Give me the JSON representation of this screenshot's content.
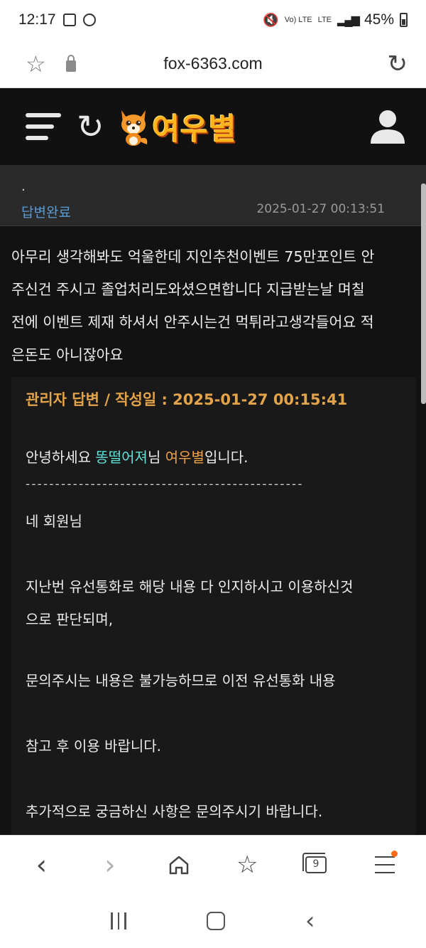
{
  "status_bar": {
    "time": "12:17",
    "volte": "Vo) LTE",
    "network": "LTE",
    "battery": "45%"
  },
  "browser": {
    "url": "fox-6363.com",
    "tab_count": "9"
  },
  "site": {
    "logo_text": "여우별"
  },
  "post": {
    "title": ".",
    "status": "답변완료",
    "date": "2025-01-27 00:13:51",
    "question_lines": [
      "아무리 생각해봐도 억울한데 지인추천이벤트 75만포인트 안",
      "주신건 주시고 졸업처리도와셨으면합니다 지급받는날 며칠",
      "전에 이벤트 제재 하셔서 안주시는건 먹튀라고생각들어요 적",
      "은돈도 아니잖아요"
    ]
  },
  "answer": {
    "header": "관리자 답변 / 작성일 : 2025-01-27 00:15:41",
    "greeting_prefix": "안녕하세요 ",
    "nickname": "똥떨어져",
    "greeting_mid": "님 ",
    "site_name": "여우별",
    "greeting_suffix": "입니다.",
    "divider": "-----------------------------------------------",
    "lines": [
      "네 회원님",
      "지난번 유선통화로 해당 내용 다 인지하시고 이용하신것",
      "으로 판단되며,",
      "문의주시는 내용은 불가능하므로 이전 유선통화 내용",
      "참고 후 이용 바랍니다.",
      "추가적으로 궁금하신 사항은 문의주시기 바랍니다."
    ]
  },
  "colors": {
    "header_bg": "#111111",
    "status_blue": "#5b9bd5",
    "answer_gold": "#e3a34a",
    "nickname_cyan": "#5ee0d6",
    "site_orange": "#f0a045"
  },
  "icons": {
    "status_left": [
      "gallery-icon",
      "messenger-icon"
    ],
    "status_right": [
      "mute-icon",
      "volte-icon",
      "lte-icon",
      "signal-icon",
      "battery-icon"
    ],
    "url_left": [
      "bookmark-star-icon",
      "lock-icon"
    ],
    "url_right": "reload-icon",
    "header": [
      "menu-icon",
      "refresh-icon",
      "fox-logo-icon",
      "user-icon"
    ],
    "bottom_nav": [
      "back-icon",
      "forward-icon",
      "home-icon",
      "bookmarks-icon",
      "tabs-icon",
      "menu-icon"
    ],
    "system_nav": [
      "recent-apps-icon",
      "home-icon",
      "back-icon"
    ]
  }
}
